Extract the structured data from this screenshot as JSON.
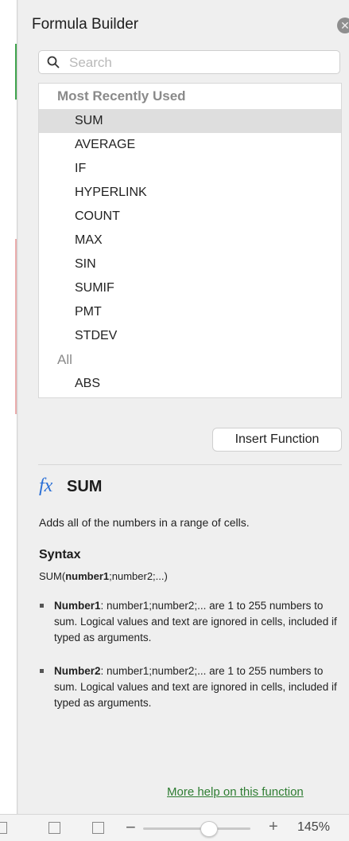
{
  "panel": {
    "title": "Formula Builder",
    "close_icon": "close-icon"
  },
  "search": {
    "placeholder": "Search",
    "value": ""
  },
  "function_list": {
    "recent_heading": "Most Recently Used",
    "recent_items": [
      "SUM",
      "AVERAGE",
      "IF",
      "HYPERLINK",
      "COUNT",
      "MAX",
      "SIN",
      "SUMIF",
      "PMT",
      "STDEV"
    ],
    "selected": "SUM",
    "all_heading": "All",
    "all_items": [
      "ABS"
    ]
  },
  "insert_button": {
    "label": "Insert Function"
  },
  "detail": {
    "fx_icon": "fx",
    "name": "SUM",
    "description": "Adds all of the numbers in a range of cells.",
    "syntax_heading": "Syntax",
    "syntax_fn": "SUM(",
    "syntax_first_arg": "number1",
    "syntax_rest": ";number2;...)",
    "args": [
      {
        "name": "Number1",
        "text": ": number1;number2;... are 1 to 255 numbers to sum. Logical values and text are ignored in cells, included if typed as arguments."
      },
      {
        "name": "Number2",
        "text": ": number1;number2;... are 1 to 255 numbers to sum. Logical values and text are ignored in cells, included if typed as arguments."
      }
    ],
    "more_help": "More help on this function"
  },
  "status_bar": {
    "zoom_minus": "−",
    "zoom_plus": "+",
    "zoom_level": "145%",
    "zoom_value": 145
  },
  "colors": {
    "accent_link": "#2e7d32",
    "fx_blue": "#2a6fd6",
    "selected_bg": "#dedede"
  }
}
